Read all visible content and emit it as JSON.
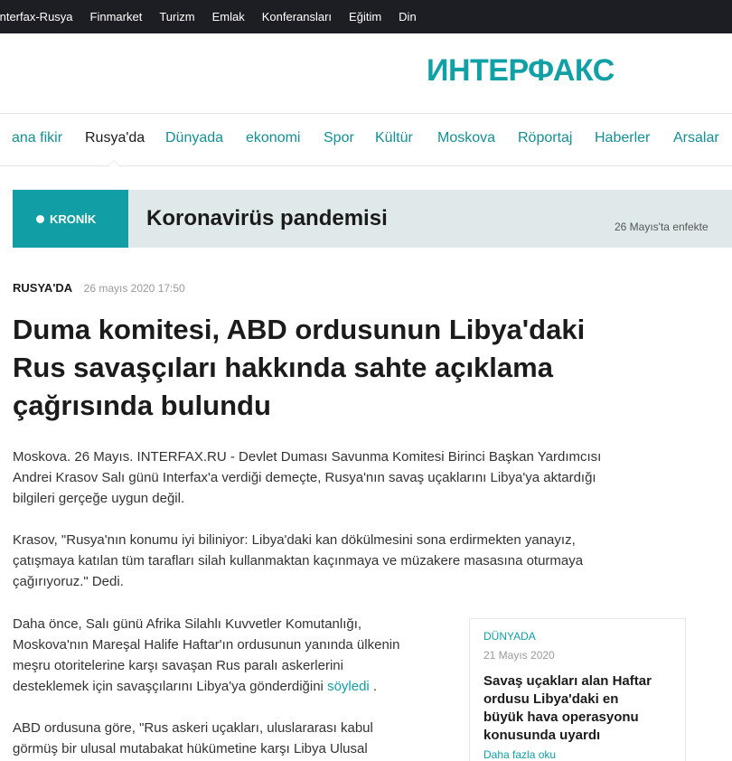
{
  "topbar": {
    "links": [
      "Interfax-Rusya",
      "Finmarket",
      "Turizm",
      "Emlak",
      "Konferansları",
      "Eğitim",
      "Din"
    ]
  },
  "logo": {
    "text": "ИНТЕРФАКС",
    "color": "#11a0a6"
  },
  "nav": {
    "items": [
      "ana fikir",
      "Rusya'da",
      "Dünyada",
      "ekonomi",
      "Spor",
      "Kültür",
      "Moskova",
      "Röportaj",
      "Haberler",
      "Arsalar"
    ],
    "active": "Rusya'da"
  },
  "kronik": {
    "tag": "KRONİK",
    "title": "Koronavirüs pandemisi",
    "note": "26 Mayıs'ta enfekte"
  },
  "article": {
    "rubric": "RUSYA'DA",
    "date": "26 mayıs 2020 17:50",
    "headline": [
      "Duma komitesi, ABD ordusunun Libya'daki",
      "Rus savaşçıları hakkında sahte açıklama",
      "çağrısında bulundu"
    ],
    "p1": [
      "Moskova. 26 Mayıs. INTERFAX.RU - Devlet Duması Savunma Komitesi Birinci Başkan Yardımcısı",
      "Andrei Krasov Salı günü Interfax'a verdiği demeçte, Rusya'nın savaş uçaklarını Libya'ya aktardığı",
      "bilgileri gerçeğe uygun değil."
    ],
    "p2": [
      "Krasov, \"Rusya'nın konumu iyi biliniyor: Libya'daki kan dökülmesini sona erdirmekten yanayız,",
      "çatışmaya katılan tüm tarafları silah kullanmaktan kaçınmaya ve müzakere masasına oturmaya",
      "çağırıyoruz.\" Dedi."
    ],
    "p3": [
      "Daha önce, Salı günü Afrika Silahlı Kuvvetler Komutanlığı,",
      "Moskova'nın Mareşal Halife Haftar'ın ordusunun yanında ülkenin",
      "meşru otoritelerine karşı savaşan Rus paralı askerlerini"
    ],
    "p3_last_text": "desteklemek için savaşçılarını Libya'ya gönderdiğini",
    "p3_link": "söyledi",
    "p3_end": " .",
    "p4": [
      "ABD ordusuna göre, \"Rus askeri uçakları, uluslararası kabul",
      "görmüş bir ulusal mutabakat hükümetine karşı Libya Ulusal"
    ]
  },
  "related": {
    "rubric": "DÜNYADA",
    "date": "21 Mayıs 2020",
    "title": [
      "Savaş uçakları alan Haftar",
      "ordusu Libya'daki en",
      "büyük hava operasyonu",
      "konusunda uyardı"
    ],
    "more": "Daha fazla oku"
  }
}
